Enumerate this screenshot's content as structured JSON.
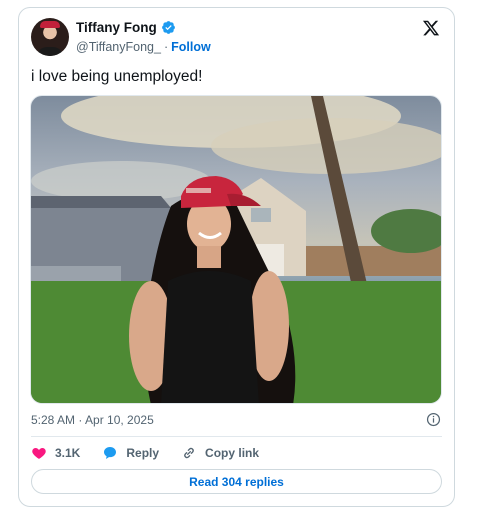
{
  "author": {
    "name": "Tiffany Fong",
    "handle": "@TiffanyFong_",
    "separator": "·",
    "follow_label": "Follow",
    "verified": true
  },
  "tweet": {
    "text": "i love being unemployed!",
    "timestamp": "5:28 AM · Apr 10, 2025"
  },
  "actions": {
    "like_count": "3.1K",
    "reply_label": "Reply",
    "copy_link_label": "Copy link"
  },
  "read_replies_label": "Read 304 replies",
  "colors": {
    "accent": "#006fd6",
    "like": "#f91880",
    "verified": "#1d9bf0",
    "text": "#0f1419",
    "muted": "#536471",
    "border": "#cfd9de"
  },
  "icons": {
    "brand": "x-logo-icon",
    "verified": "verified-badge-icon",
    "info": "info-icon",
    "like": "heart-icon",
    "reply": "reply-bubble-icon",
    "copy": "link-icon"
  }
}
